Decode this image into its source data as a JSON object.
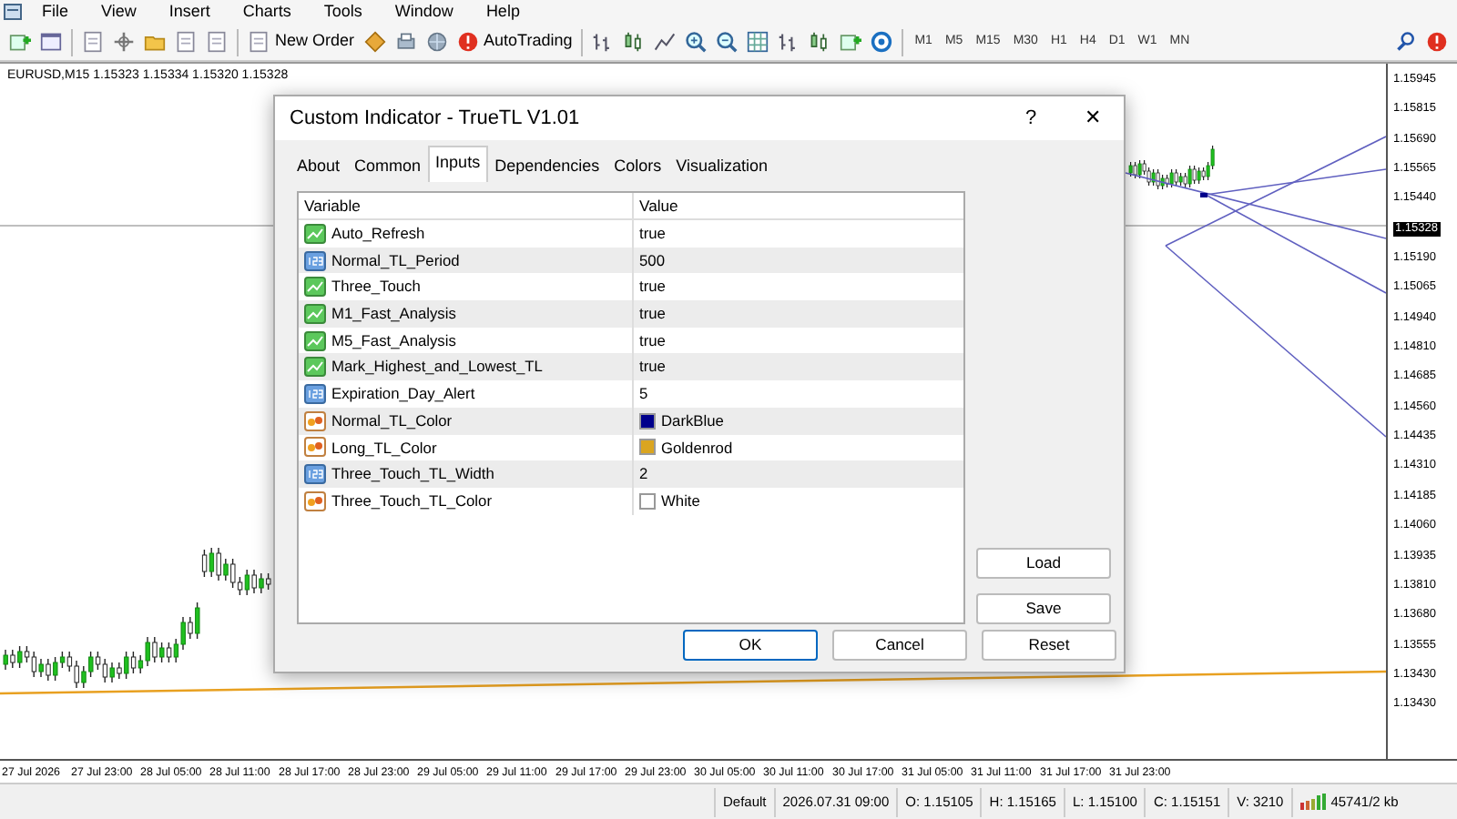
{
  "menu": [
    "File",
    "View",
    "Insert",
    "Charts",
    "Tools",
    "Window",
    "Help"
  ],
  "toolbar": {
    "new_order": "New Order",
    "autotrading": "AutoTrading",
    "timeframes": [
      "M1",
      "M5",
      "M15",
      "M30",
      "H1",
      "H4",
      "D1",
      "W1",
      "MN"
    ]
  },
  "chart": {
    "header": "EURUSD,M15  1.15323 1.15334 1.15320 1.15328",
    "price_axis": [
      {
        "label": "1.15945",
        "kind": "tick"
      },
      {
        "label": "1.15815",
        "kind": "tick"
      },
      {
        "label": "1.15690",
        "kind": "tick"
      },
      {
        "label": "1.15565",
        "kind": "tick"
      },
      {
        "label": "1.15440",
        "kind": "tick"
      },
      {
        "label": "1.15328",
        "kind": "current"
      },
      {
        "label": "1.15190",
        "kind": "tick"
      },
      {
        "label": "1.15065",
        "kind": "tick"
      },
      {
        "label": "1.14940",
        "kind": "tick"
      },
      {
        "label": "1.14810",
        "kind": "tick"
      },
      {
        "label": "1.14685",
        "kind": "tick"
      },
      {
        "label": "1.14560",
        "kind": "tick"
      },
      {
        "label": "1.14435",
        "kind": "tick"
      },
      {
        "label": "1.14310",
        "kind": "tick"
      },
      {
        "label": "1.14185",
        "kind": "tick"
      },
      {
        "label": "1.14060",
        "kind": "tick"
      },
      {
        "label": "1.13935",
        "kind": "tick"
      },
      {
        "label": "1.13810",
        "kind": "tick"
      },
      {
        "label": "1.13680",
        "kind": "tick"
      },
      {
        "label": "1.13555",
        "kind": "tick"
      },
      {
        "label": "1.13430",
        "kind": "tick"
      },
      {
        "label": "1.13430",
        "kind": "tick"
      }
    ],
    "time_axis": [
      "27 Jul 2026",
      "27 Jul 23:00",
      "28 Jul 05:00",
      "28 Jul 11:00",
      "28 Jul 17:00",
      "28 Jul 23:00",
      "29 Jul 05:00",
      "29 Jul 11:00",
      "29 Jul 17:00",
      "29 Jul 23:00",
      "30 Jul 05:00",
      "30 Jul 11:00",
      "30 Jul 17:00",
      "31 Jul 05:00",
      "31 Jul 11:00",
      "31 Jul 17:00",
      "31 Jul 23:00"
    ]
  },
  "dialog": {
    "title": "Custom Indicator - TrueTL V1.01",
    "help": "?",
    "close": "✕",
    "tabs": [
      {
        "label": "About",
        "selected": false
      },
      {
        "label": "Common",
        "selected": false
      },
      {
        "label": "Inputs",
        "selected": true
      },
      {
        "label": "Dependencies",
        "selected": false
      },
      {
        "label": "Colors",
        "selected": false
      },
      {
        "label": "Visualization",
        "selected": false
      }
    ],
    "columns": [
      "Variable",
      "Value"
    ],
    "rows": [
      {
        "kind": "bool",
        "variable": "Auto_Refresh",
        "value": "true"
      },
      {
        "kind": "int",
        "variable": "Normal_TL_Period",
        "value": "500"
      },
      {
        "kind": "bool",
        "variable": "Three_Touch",
        "value": "true"
      },
      {
        "kind": "bool",
        "variable": "M1_Fast_Analysis",
        "value": "true"
      },
      {
        "kind": "bool",
        "variable": "M5_Fast_Analysis",
        "value": "true"
      },
      {
        "kind": "bool",
        "variable": "Mark_Highest_and_Lowest_TL",
        "value": "true"
      },
      {
        "kind": "int",
        "variable": "Expiration_Day_Alert",
        "value": "5"
      },
      {
        "kind": "color",
        "variable": "Normal_TL_Color",
        "value": "DarkBlue",
        "color": "#00008b"
      },
      {
        "kind": "color",
        "variable": "Long_TL_Color",
        "value": "Goldenrod",
        "color": "#daa520"
      },
      {
        "kind": "int",
        "variable": "Three_Touch_TL_Width",
        "value": "2"
      },
      {
        "kind": "color",
        "variable": "Three_Touch_TL_Color",
        "value": "White",
        "color": "#ffffff"
      }
    ],
    "side_buttons": [
      "Load",
      "Save"
    ],
    "buttons": [
      "OK",
      "Cancel",
      "Reset"
    ]
  },
  "status_bar": [
    "Default",
    "2026.07.31 09:00",
    "O: 1.15105",
    "H: 1.15165",
    "L: 1.15100",
    "C: 1.15151",
    "V: 3210",
    "45741/2 kb"
  ]
}
